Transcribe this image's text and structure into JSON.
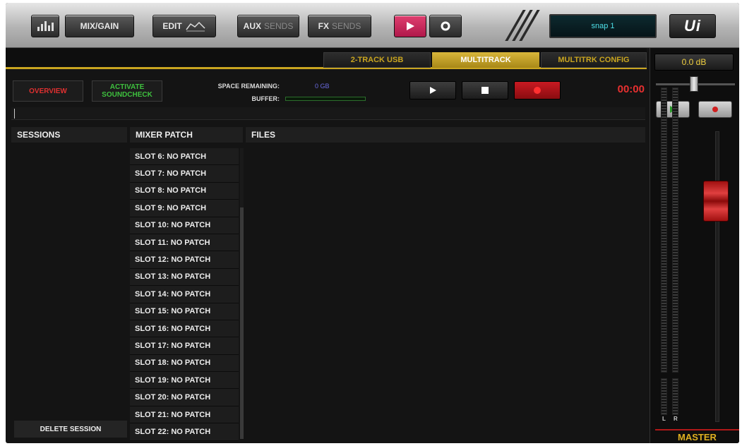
{
  "topbar": {
    "mix_gain": "MIX/GAIN",
    "edit": "EDIT",
    "aux_a": "AUX",
    "aux_b": "SENDS",
    "fx_a": "FX",
    "fx_b": "SENDS",
    "snapshot": "snap 1",
    "logo": "Ui"
  },
  "tabs": [
    {
      "label": "2-TRACK USB",
      "active": false
    },
    {
      "label": "MULTITRACK",
      "active": true
    },
    {
      "label": "MULTITRK CONFIG",
      "active": false
    }
  ],
  "controls": {
    "overview": "OVERVIEW",
    "activate_soundcheck": "ACTIVATE SOUNDCHECK",
    "space_label": "SPACE REMAINING:",
    "space_value": "0 GB",
    "buffer_label": "BUFFER:",
    "timer": "00:00"
  },
  "panels": {
    "sessions_title": "SESSIONS",
    "mixer_patch_title": "MIXER PATCH",
    "files_title": "FILES",
    "delete_session": "DELETE SESSION"
  },
  "slots": [
    "SLOT 6: NO PATCH",
    "SLOT 7: NO PATCH",
    "SLOT 8: NO PATCH",
    "SLOT 9: NO PATCH",
    "SLOT 10: NO PATCH",
    "SLOT 11: NO PATCH",
    "SLOT 12: NO PATCH",
    "SLOT 13: NO PATCH",
    "SLOT 14: NO PATCH",
    "SLOT 15: NO PATCH",
    "SLOT 16: NO PATCH",
    "SLOT 17: NO PATCH",
    "SLOT 18: NO PATCH",
    "SLOT 19: NO PATCH",
    "SLOT 20: NO PATCH",
    "SLOT 21: NO PATCH",
    "SLOT 22: NO PATCH"
  ],
  "master": {
    "db": "0.0 dB",
    "left": "L",
    "right": "R",
    "label": "MASTER"
  },
  "colors": {
    "accent_gold": "#c9a520",
    "overview_red": "#e03030",
    "soundcheck_green": "#3ec03e",
    "timer_red": "#e83030"
  }
}
